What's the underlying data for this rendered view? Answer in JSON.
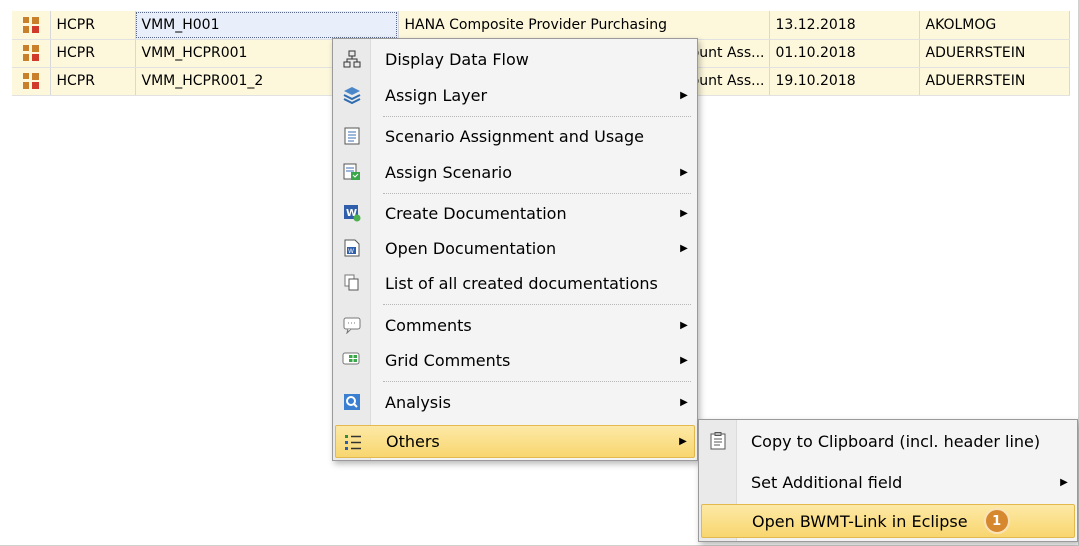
{
  "grid": {
    "rows": [
      {
        "type": "HCPR",
        "name": "VMM_H001",
        "description": "HANA Composite Provider Purchasing",
        "date": "13.12.2018",
        "user": "AKOLMOG"
      },
      {
        "type": "HCPR",
        "name": "VMM_HCPR001",
        "description": "ccount Ass...",
        "date": "01.10.2018",
        "user": "ADUERRSTEIN"
      },
      {
        "type": "HCPR",
        "name": "VMM_HCPR001_2",
        "description": "ccount Ass...",
        "date": "19.10.2018",
        "user": "ADUERRSTEIN"
      }
    ]
  },
  "context_menu": {
    "items": [
      {
        "label": "Display Data Flow",
        "icon": "data-flow-icon"
      },
      {
        "label": "Assign Layer",
        "icon": "layers-icon",
        "submenu": true
      },
      {
        "label": "Scenario Assignment and Usage",
        "icon": "document-list-icon"
      },
      {
        "label": "Assign Scenario",
        "icon": "assign-scenario-icon",
        "submenu": true
      },
      {
        "label": "Create Documentation",
        "icon": "create-doc-icon",
        "submenu": true
      },
      {
        "label": "Open Documentation",
        "icon": "word-doc-icon",
        "submenu": true
      },
      {
        "label": "List of all created documentations",
        "icon": "copy-docs-icon"
      },
      {
        "label": "Comments",
        "icon": "comment-icon",
        "submenu": true
      },
      {
        "label": "Grid Comments",
        "icon": "grid-comment-icon",
        "submenu": true
      },
      {
        "label": "Analysis",
        "icon": "analysis-search-icon",
        "submenu": true
      },
      {
        "label": "Others",
        "icon": "list-icon",
        "submenu": true,
        "highlighted": true
      }
    ]
  },
  "submenu": {
    "items": [
      {
        "label": "Copy to Clipboard (incl. header line)",
        "icon": "clipboard-icon"
      },
      {
        "label": "Set Additional field",
        "submenu": true
      },
      {
        "label": "Open BWMT-Link in Eclipse",
        "highlighted": true,
        "badge": "1"
      }
    ]
  },
  "colors": {
    "highlight": "#f8d66f",
    "badge": "#d6882e",
    "row_bg": "#fdf8dc"
  }
}
